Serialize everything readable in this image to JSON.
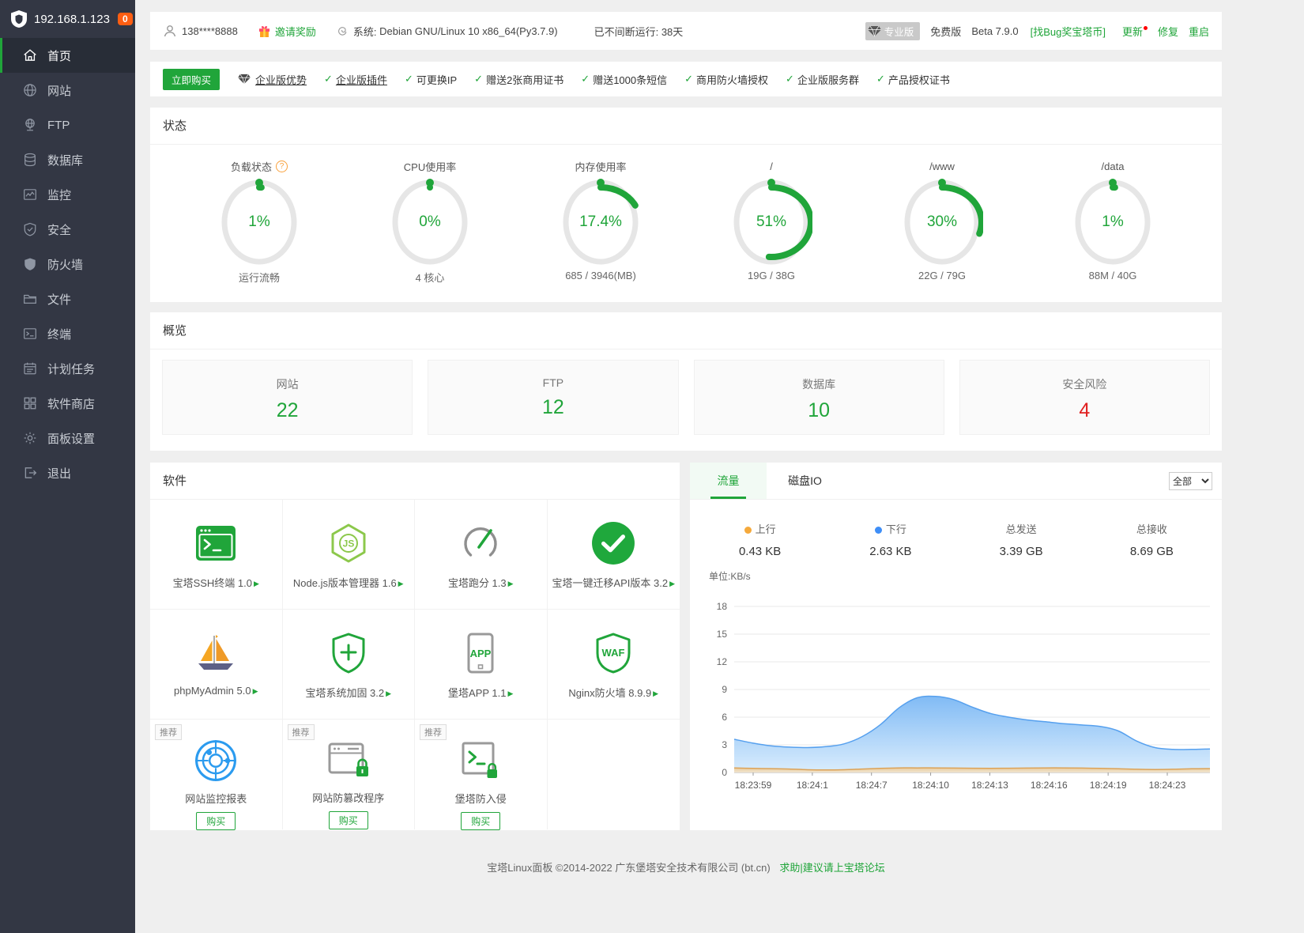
{
  "accent_color": "#20a53a",
  "sidebar": {
    "logo_ip": "192.168.1.123",
    "badge": "0",
    "items": [
      {
        "id": "home",
        "label": "首页",
        "icon": "home-icon",
        "active": true
      },
      {
        "id": "site",
        "label": "网站",
        "icon": "globe-icon"
      },
      {
        "id": "ftp",
        "label": "FTP",
        "icon": "ftp-icon"
      },
      {
        "id": "database",
        "label": "数据库",
        "icon": "database-icon"
      },
      {
        "id": "monitor",
        "label": "监控",
        "icon": "monitor-icon"
      },
      {
        "id": "security",
        "label": "安全",
        "icon": "shield-check-icon"
      },
      {
        "id": "firewall",
        "label": "防火墙",
        "icon": "firewall-shield-icon"
      },
      {
        "id": "files",
        "label": "文件",
        "icon": "folder-icon"
      },
      {
        "id": "terminal",
        "label": "终端",
        "icon": "terminal-icon"
      },
      {
        "id": "crontab",
        "label": "计划任务",
        "icon": "calendar-icon"
      },
      {
        "id": "soft-store",
        "label": "软件商店",
        "icon": "grid-icon"
      },
      {
        "id": "panel-config",
        "label": "面板设置",
        "icon": "gear-icon"
      },
      {
        "id": "logout",
        "label": "退出",
        "icon": "logout-icon"
      }
    ]
  },
  "topbar": {
    "user": "138****8888",
    "invite": "邀请奖励",
    "system_label": "系统:",
    "system_value": "Debian GNU/Linux 10 x86_64(Py3.7.9)",
    "uptime": "已不间断运行: 38天",
    "pro_badge": "专业版",
    "free_label": "免费版",
    "beta": "Beta 7.9.0",
    "bug_link": "[找Bug奖宝塔币]",
    "update": "更新",
    "repair": "修复",
    "restart": "重启"
  },
  "promo": {
    "buy_button": "立即购买",
    "adv_label": "企业版优势",
    "features": [
      {
        "label": "企业版插件",
        "underline": true
      },
      {
        "label": "可更换IP"
      },
      {
        "label": "赠送2张商用证书"
      },
      {
        "label": "赠送1000条短信"
      },
      {
        "label": "商用防火墙授权"
      },
      {
        "label": "企业版服务群"
      },
      {
        "label": "产品授权证书"
      }
    ]
  },
  "status": {
    "title": "状态",
    "gauges": [
      {
        "title": "负载状态",
        "has_help": true,
        "value": "1%",
        "percent": 1,
        "sub": "运行流畅"
      },
      {
        "title": "CPU使用率",
        "has_help": false,
        "value": "0%",
        "percent": 0,
        "sub": "4 核心"
      },
      {
        "title": "内存使用率",
        "has_help": false,
        "value": "17.4%",
        "percent": 17.4,
        "sub": "685 / 3946(MB)"
      },
      {
        "title": "/",
        "has_help": false,
        "value": "51%",
        "percent": 51,
        "sub": "19G / 38G"
      },
      {
        "title": "/www",
        "has_help": false,
        "value": "30%",
        "percent": 30,
        "sub": "22G / 79G"
      },
      {
        "title": "/data",
        "has_help": false,
        "value": "1%",
        "percent": 1,
        "sub": "88M / 40G"
      }
    ]
  },
  "overview": {
    "title": "概览",
    "cards": [
      {
        "id": "sites",
        "label": "网站",
        "value": "22",
        "value_color": "#20a53a"
      },
      {
        "id": "ftp",
        "label": "FTP",
        "value": "12",
        "value_color": "#20a53a"
      },
      {
        "id": "databases",
        "label": "数据库",
        "value": "10",
        "value_color": "#20a53a"
      },
      {
        "id": "risks",
        "label": "安全风险",
        "value": "4",
        "value_color": "#e02020"
      }
    ]
  },
  "software": {
    "title": "软件",
    "items": [
      {
        "id": "ssh-terminal",
        "name": "宝塔SSH终端 1.0",
        "icon": "ssh-terminal-icon"
      },
      {
        "id": "nodejs-manager",
        "name": "Node.js版本管理器 1.6",
        "icon": "nodejs-icon"
      },
      {
        "id": "benchmark",
        "name": "宝塔跑分 1.3",
        "icon": "benchmark-icon"
      },
      {
        "id": "migrate-api",
        "name": "宝塔一键迁移API版本 3.2",
        "icon": "migrate-check-icon"
      },
      {
        "id": "phpmyadmin",
        "name": "phpMyAdmin 5.0",
        "icon": "phpmyadmin-icon"
      },
      {
        "id": "system-harden",
        "name": "宝塔系统加固 3.2",
        "icon": "shield-plus-icon"
      },
      {
        "id": "bt-app",
        "name": "堡塔APP 1.1",
        "icon": "app-icon"
      },
      {
        "id": "nginx-waf",
        "name": "Nginx防火墙 8.9.9",
        "icon": "waf-icon"
      }
    ],
    "recommended": [
      {
        "id": "site-monitor-report",
        "name": "网站监控报表",
        "icon": "monitor-report-icon",
        "tag": "推荐",
        "buy": "购买"
      },
      {
        "id": "tamper-proof",
        "name": "网站防篡改程序",
        "icon": "tamper-proof-icon",
        "tag": "推荐",
        "buy": "购买"
      },
      {
        "id": "anti-intrusion",
        "name": "堡塔防入侵",
        "icon": "intrusion-icon",
        "tag": "推荐",
        "buy": "购买"
      }
    ]
  },
  "chart_card": {
    "tabs": [
      "流量",
      "磁盘IO"
    ],
    "active_tab": "流量",
    "filter": "全部",
    "legend": [
      {
        "label": "上行",
        "value": "0.43 KB",
        "dot": "#f5a93b"
      },
      {
        "label": "下行",
        "value": "2.63 KB",
        "dot": "#3e8ef7"
      },
      {
        "label": "总发送",
        "value": "3.39 GB",
        "dot": ""
      },
      {
        "label": "总接收",
        "value": "8.69 GB",
        "dot": ""
      }
    ]
  },
  "chart_data": {
    "type": "area",
    "title": "单位:KB/s",
    "unit": "KB/s",
    "x_labels": [
      "18:23:59",
      "18:24:1",
      "18:24:7",
      "18:24:10",
      "18:24:13",
      "18:24:16",
      "18:24:19",
      "18:24:23"
    ],
    "ylim": [
      0,
      18
    ],
    "yticks": [
      0,
      3,
      6,
      9,
      12,
      15,
      18
    ],
    "grid": true,
    "legend_position": "top",
    "series": [
      {
        "name": "下行",
        "color": "#56a0ee",
        "fill_top": "#7ab7f4",
        "fill_bottom": "#d8ecfd",
        "values": [
          3.6,
          3.2,
          2.9,
          2.75,
          2.7,
          2.8,
          3.1,
          3.9,
          5.2,
          7.0,
          8.1,
          8.25,
          7.9,
          7.1,
          6.4,
          6.0,
          5.7,
          5.5,
          5.3,
          5.15,
          5.0,
          4.5,
          3.4,
          2.7,
          2.5,
          2.5,
          2.55
        ]
      },
      {
        "name": "上行",
        "color": "#dca256",
        "fill_top": "#eec489",
        "fill_bottom": "#f6e3c2",
        "values": [
          0.5,
          0.45,
          0.42,
          0.38,
          0.3,
          0.27,
          0.3,
          0.38,
          0.45,
          0.5,
          0.5,
          0.5,
          0.48,
          0.46,
          0.45,
          0.46,
          0.48,
          0.5,
          0.5,
          0.48,
          0.45,
          0.4,
          0.35,
          0.33,
          0.35,
          0.4,
          0.42
        ]
      }
    ]
  },
  "footer": {
    "text": "宝塔Linux面板 ©2014-2022 广东堡塔安全技术有限公司 (bt.cn)",
    "link": "求助|建议请上宝塔论坛"
  }
}
